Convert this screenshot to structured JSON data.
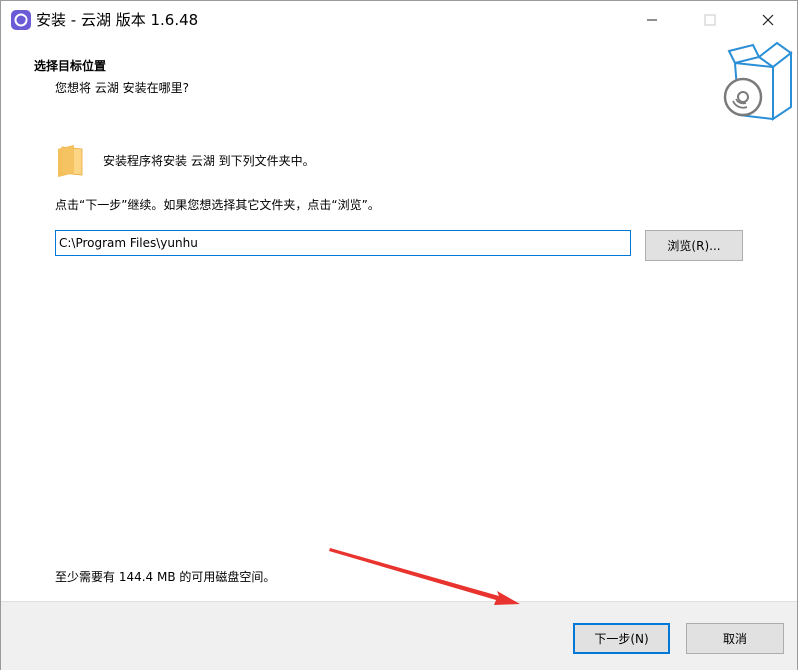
{
  "window": {
    "title": "安装 - 云湖 版本 1.6.48"
  },
  "header": {
    "title": "选择目标位置",
    "subtitle": "您想将 云湖 安装在哪里?"
  },
  "main": {
    "install_to_text": "安装程序将安装 云湖 到下列文件夹中。",
    "instruction_text": "点击“下一步”继续。如果您想选择其它文件夹，点击“浏览”。",
    "path_value": "C:\\Program Files\\yunhu",
    "browse_label": "浏览(R)...",
    "space_required_text": "至少需要有 144.4 MB 的可用磁盘空间。"
  },
  "footer": {
    "next_label": "下一步(N)",
    "cancel_label": "取消"
  },
  "colors": {
    "accent": "#0078d7",
    "annotation_arrow": "#e8332e",
    "app_icon": "#6b5bd6"
  }
}
